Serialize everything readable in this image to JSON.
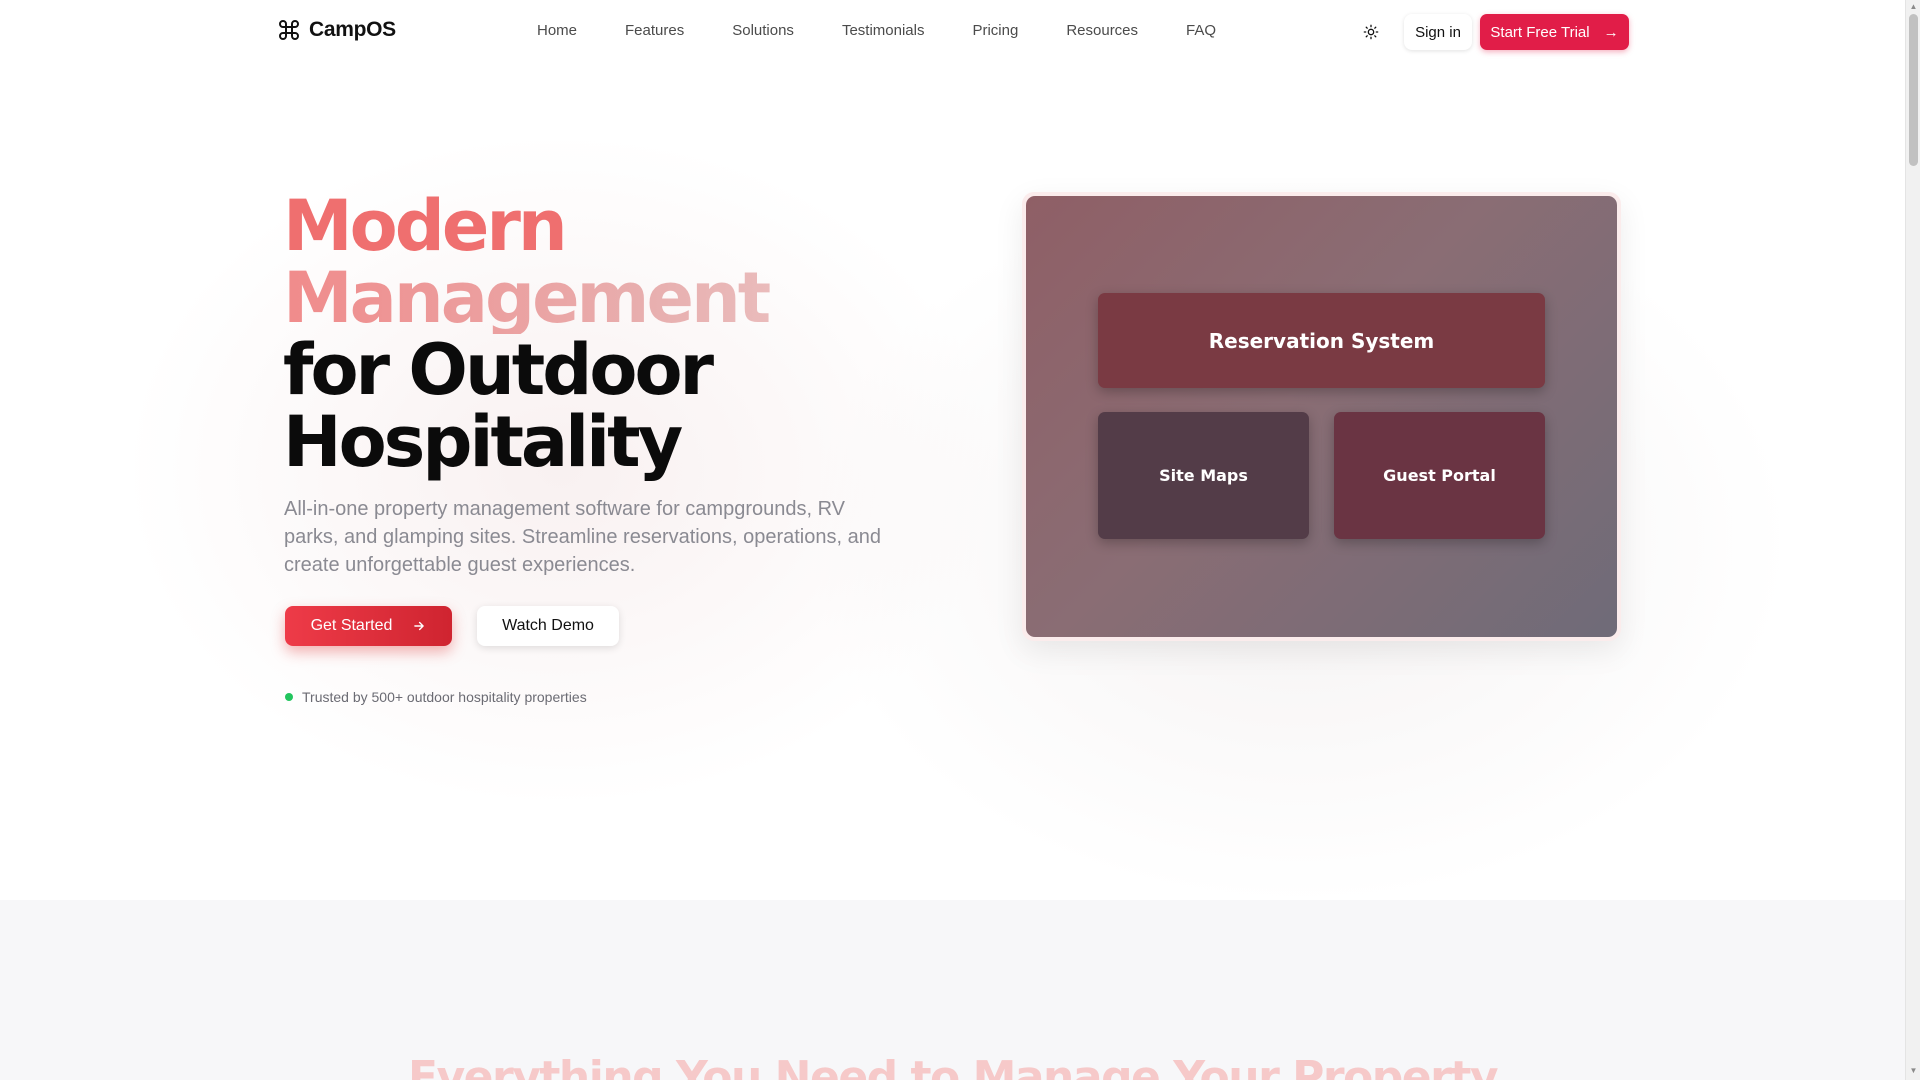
{
  "brand": {
    "name": "CampOS",
    "icon": "command-icon"
  },
  "nav": {
    "links": [
      "Home",
      "Features",
      "Solutions",
      "Testimonials",
      "Pricing",
      "Resources",
      "FAQ"
    ],
    "theme_icon": "sun-icon",
    "signin_label": "Sign in",
    "trial_label": "Start Free Trial",
    "trial_arrow": "→"
  },
  "hero": {
    "title_line1": "Modern",
    "title_line2": "Management",
    "title_line3": "for Outdoor",
    "title_line4": "Hospitality",
    "description": "All-in-one property management software for campgrounds, RV parks, and glamping sites. Streamline reservations, operations, and create unforgettable guest experiences.",
    "primary_label": "Get Started",
    "primary_icon": "arrow-right-icon",
    "secondary_label": "Watch Demo",
    "trust_text": "Trusted by 500+ outdoor hospitality properties"
  },
  "preview": {
    "card_reservation": "Reservation System",
    "card_sitemaps": "Site Maps",
    "card_guest": "Guest Portal"
  },
  "section2": {
    "title": "Everything You Need to Manage Your Property"
  },
  "colors": {
    "accent": "#e11d48",
    "primary_button": "#dc2626",
    "trust_dot": "#22c55e"
  }
}
